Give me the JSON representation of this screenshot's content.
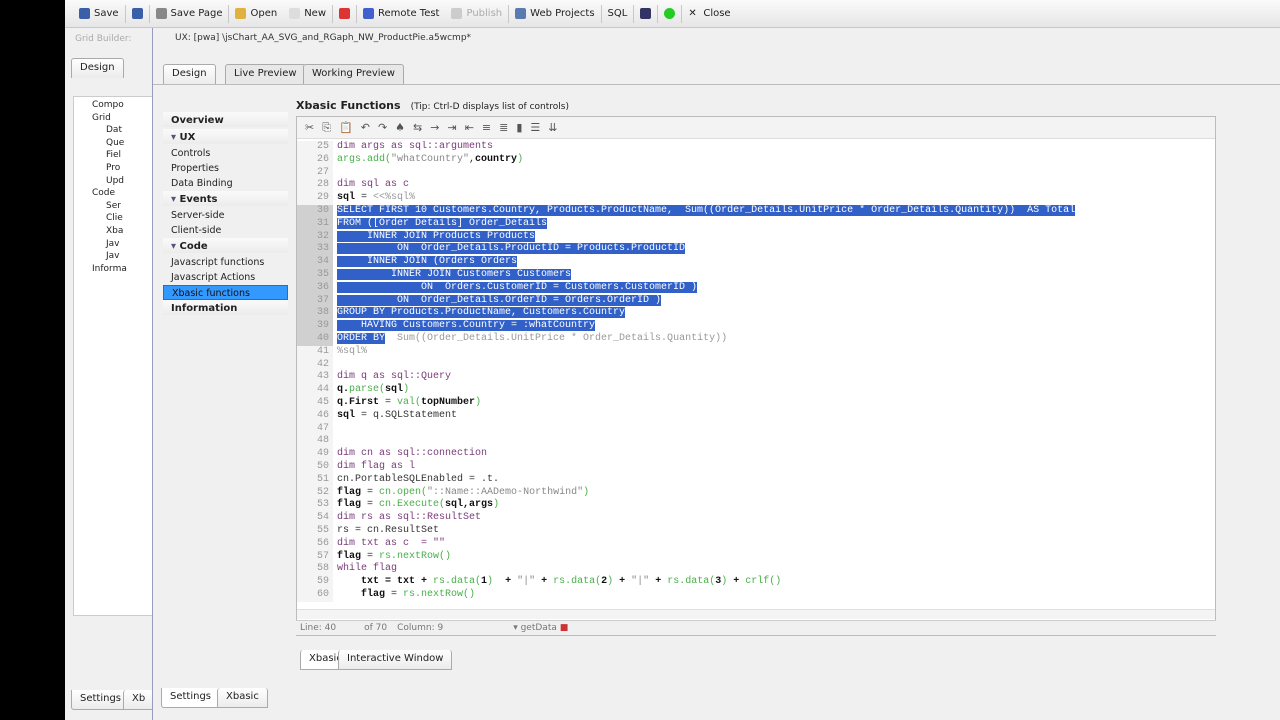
{
  "toolbar": {
    "items": [
      {
        "label": "Save",
        "icon": "save-icon"
      },
      {
        "label": "",
        "icon": "save-as-icon"
      },
      {
        "label": "Save Page",
        "icon": "save-page-icon"
      },
      {
        "label": "Open",
        "icon": "folder-icon"
      },
      {
        "label": "New",
        "icon": "new-file-icon"
      },
      {
        "label": "",
        "icon": "browser-icon"
      },
      {
        "label": "Remote Test",
        "icon": "lightning-icon"
      },
      {
        "label": "Publish",
        "icon": "publish-icon",
        "disabled": true
      },
      {
        "label": "Web Projects",
        "icon": "web-projects-icon"
      },
      {
        "label": "SQL",
        "icon": ""
      },
      {
        "label": "",
        "icon": "font-icon"
      },
      {
        "label": "",
        "icon": "green-status-icon"
      },
      {
        "label": "Close",
        "icon": "close-icon"
      }
    ]
  },
  "left_panel": {
    "title": "Grid Builder:",
    "tab": "Design",
    "tree": [
      "Compo",
      "Grid",
      "Dat",
      "Que",
      "Fiel",
      "Pro",
      "Upd",
      "Code",
      "Ser",
      "Clie",
      "Xba",
      "Jav",
      "Jav",
      "Informa"
    ],
    "bottom_tabs": [
      "Settings",
      "Xb"
    ]
  },
  "window": {
    "title": "UX: [pwa] \\jsChart_AA_SVG_and_RGaph_NW_ProductPie.a5wcmp*",
    "tabs": [
      "Design",
      "Live Preview",
      "Working Preview"
    ],
    "nav": [
      {
        "label": "Overview",
        "type": "h"
      },
      {
        "label": "UX",
        "type": "h",
        "arrow": true
      },
      {
        "label": "Controls",
        "type": "i"
      },
      {
        "label": "Properties",
        "type": "i"
      },
      {
        "label": "Data Binding",
        "type": "i"
      },
      {
        "label": "Events",
        "type": "h",
        "arrow": true
      },
      {
        "label": "Server-side",
        "type": "i"
      },
      {
        "label": "Client-side",
        "type": "i"
      },
      {
        "label": "Code",
        "type": "h",
        "arrow": true
      },
      {
        "label": "Javascript functions",
        "type": "i"
      },
      {
        "label": "Javascript Actions",
        "type": "i"
      },
      {
        "label": "Xbasic functions",
        "type": "i",
        "selected": true
      },
      {
        "label": "Information",
        "type": "h"
      }
    ],
    "section_title": "Xbasic Functions",
    "tip": "(Tip: Ctrl-D displays list of controls)",
    "bottom_tabs": [
      "Settings",
      "Xbasic"
    ]
  },
  "editor": {
    "lines": [
      {
        "n": "25",
        "seg": [
          [
            "dim args as sql::arguments",
            "k"
          ]
        ]
      },
      {
        "n": "26",
        "seg": [
          [
            "args.add(",
            "f"
          ],
          [
            "\"whatCountry\"",
            "s"
          ],
          [
            ",",
            "n"
          ],
          [
            "country",
            "b"
          ],
          [
            ")",
            "f"
          ]
        ]
      },
      {
        "n": "27",
        "seg": []
      },
      {
        "n": "28",
        "seg": [
          [
            "dim sql as c",
            "k"
          ]
        ]
      },
      {
        "n": "29",
        "seg": [
          [
            "sql",
            "b"
          ],
          [
            " = ",
            "n"
          ],
          [
            "<<%sql%",
            "c"
          ]
        ]
      },
      {
        "n": "30",
        "sel": true,
        "seg": [
          [
            "SELECT FIRST 10 Customers.Country, Products.ProductName,  Sum((Order_Details.UnitPrice * Order_Details.Quantity))  AS Total",
            "c"
          ]
        ]
      },
      {
        "n": "31",
        "sel": true,
        "seg": [
          [
            "FROM ([Order Details] Order_Details",
            "c"
          ]
        ]
      },
      {
        "n": "32",
        "sel": true,
        "seg": [
          [
            "     INNER JOIN Products Products",
            "c"
          ]
        ]
      },
      {
        "n": "33",
        "sel": true,
        "seg": [
          [
            "          ON  Order_Details.ProductID = Products.ProductID",
            "c"
          ]
        ]
      },
      {
        "n": "34",
        "sel": true,
        "seg": [
          [
            "     INNER JOIN (Orders Orders",
            "c"
          ]
        ]
      },
      {
        "n": "35",
        "sel": true,
        "seg": [
          [
            "         INNER JOIN Customers Customers",
            "c"
          ]
        ]
      },
      {
        "n": "36",
        "sel": true,
        "seg": [
          [
            "              ON  Orders.CustomerID = Customers.CustomerID )",
            "c"
          ]
        ]
      },
      {
        "n": "37",
        "sel": true,
        "seg": [
          [
            "          ON  Order_Details.OrderID = Orders.OrderID )",
            "c"
          ]
        ]
      },
      {
        "n": "38",
        "sel": true,
        "seg": [
          [
            "GROUP BY Products.ProductName, Customers.Country",
            "c"
          ]
        ]
      },
      {
        "n": "39",
        "sel": true,
        "seg": [
          [
            "    HAVING Customers.Country = :whatCountry",
            "c"
          ]
        ]
      },
      {
        "n": "40",
        "sel": true,
        "partial": "ORDER BY",
        "seg": [
          [
            "  Sum((Order_Details.UnitPrice * Order_Details.Quantity))",
            "c"
          ]
        ]
      },
      {
        "n": "41",
        "seg": [
          [
            "%sql%",
            "c"
          ]
        ]
      },
      {
        "n": "42",
        "seg": []
      },
      {
        "n": "43",
        "seg": [
          [
            "dim q as sql::Query",
            "k"
          ]
        ]
      },
      {
        "n": "44",
        "seg": [
          [
            "q.",
            "b"
          ],
          [
            "parse",
            "f"
          ],
          [
            "(",
            "f"
          ],
          [
            "sql",
            "b"
          ],
          [
            ")",
            "f"
          ]
        ]
      },
      {
        "n": "45",
        "seg": [
          [
            "q.First",
            "b"
          ],
          [
            " = ",
            "n"
          ],
          [
            "val(",
            "f"
          ],
          [
            "topNumber",
            "b"
          ],
          [
            ")",
            "f"
          ]
        ]
      },
      {
        "n": "46",
        "seg": [
          [
            "sql",
            "b"
          ],
          [
            " = q.SQLStatement",
            "n"
          ]
        ]
      },
      {
        "n": "47",
        "seg": []
      },
      {
        "n": "48",
        "seg": []
      },
      {
        "n": "49",
        "seg": [
          [
            "dim cn as sql::connection",
            "k"
          ]
        ]
      },
      {
        "n": "50",
        "seg": [
          [
            "dim flag as l",
            "k"
          ]
        ]
      },
      {
        "n": "51",
        "seg": [
          [
            "cn.PortableSQLEnabled = .t.",
            "n"
          ]
        ]
      },
      {
        "n": "52",
        "seg": [
          [
            "flag",
            "b"
          ],
          [
            " = ",
            "n"
          ],
          [
            "cn.open(",
            "f"
          ],
          [
            "\"::Name::AADemo-Northwind\"",
            "s"
          ],
          [
            ")",
            "f"
          ]
        ]
      },
      {
        "n": "53",
        "seg": [
          [
            "flag",
            "b"
          ],
          [
            " = ",
            "n"
          ],
          [
            "cn.Execute(",
            "f"
          ],
          [
            "sql,args",
            "b"
          ],
          [
            ")",
            "f"
          ]
        ]
      },
      {
        "n": "54",
        "seg": [
          [
            "dim rs as sql::ResultSet",
            "k"
          ]
        ]
      },
      {
        "n": "55",
        "seg": [
          [
            "rs = cn.ResultSet",
            "n"
          ]
        ]
      },
      {
        "n": "56",
        "seg": [
          [
            "dim txt as c  = \"\"",
            "k"
          ]
        ]
      },
      {
        "n": "57",
        "seg": [
          [
            "flag",
            "b"
          ],
          [
            " = ",
            "n"
          ],
          [
            "rs.nextRow()",
            "f"
          ]
        ]
      },
      {
        "n": "58",
        "seg": [
          [
            "while flag",
            "k"
          ]
        ]
      },
      {
        "n": "59",
        "seg": [
          [
            "    txt = txt + ",
            "b"
          ],
          [
            "rs.data(",
            "f"
          ],
          [
            "1",
            "b"
          ],
          [
            ")",
            "f"
          ],
          [
            "  + ",
            "b"
          ],
          [
            "\"|\"",
            "s"
          ],
          [
            " + ",
            "b"
          ],
          [
            "rs.data(",
            "f"
          ],
          [
            "2",
            "b"
          ],
          [
            ")",
            "f"
          ],
          [
            " + ",
            "b"
          ],
          [
            "\"|\"",
            "s"
          ],
          [
            " + ",
            "b"
          ],
          [
            "rs.data(",
            "f"
          ],
          [
            "3",
            "b"
          ],
          [
            ")",
            "f"
          ],
          [
            " + ",
            "b"
          ],
          [
            "crlf()",
            "f"
          ]
        ]
      },
      {
        "n": "60",
        "seg": [
          [
            "    flag",
            "b"
          ],
          [
            " = ",
            "n"
          ],
          [
            "rs.nextRow()",
            "f"
          ]
        ]
      }
    ],
    "status": {
      "line": "Line: 40",
      "of": "of 70",
      "column": "Column: 9",
      "function": "getData"
    },
    "bottom_tabs": [
      "Xbasic",
      "Interactive Window"
    ]
  }
}
